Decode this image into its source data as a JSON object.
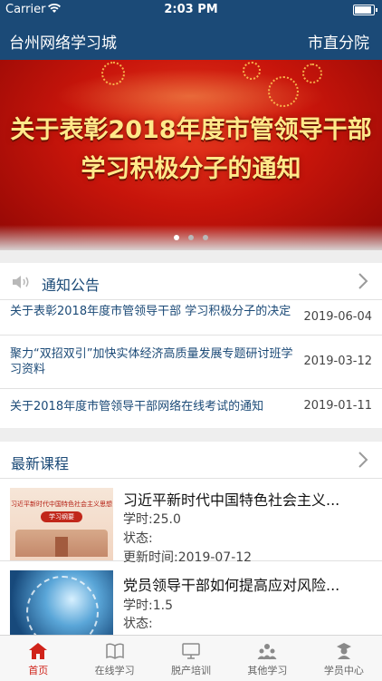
{
  "status_bar": {
    "carrier": "Carrier",
    "time": "2:03 PM"
  },
  "header": {
    "title": "台州网络学习城",
    "branch": "市直分院"
  },
  "banner": {
    "line1": "关于表彰2018年度市管领导干部",
    "line2": "学习积极分子的通知",
    "slide_count": 3,
    "active_slide": 1
  },
  "notices": {
    "title": "通知公告",
    "items": [
      {
        "text": "关于表彰2018年度市管领导干部 学习积极分子的决定",
        "date": "2019-06-04"
      },
      {
        "text": "聚力“双招双引”加快实体经济高质量发展专题研讨班学习资料",
        "date": "2019-03-12"
      },
      {
        "text": "关于2018年度市管领导干部网络在线考试的通知",
        "date": "2019-01-11"
      }
    ]
  },
  "courses": {
    "title": "最新课程",
    "items": [
      {
        "title": "习近平新时代中国特色社会主义...",
        "hours": "学时:25.0",
        "status": "状态:",
        "updated": "更新时间:2019-07-12",
        "thumb_caption": "习近平新时代中国特色社会主义思想",
        "thumb_tag": "学习纲要"
      },
      {
        "title": "党员领导干部如何提高应对风险...",
        "hours": "学时:1.5",
        "status": "状态:"
      }
    ]
  },
  "tab_bar": {
    "tabs": [
      {
        "label": "首页",
        "icon": "home-icon",
        "active": true
      },
      {
        "label": "在线学习",
        "icon": "book-icon",
        "active": false
      },
      {
        "label": "脱产培训",
        "icon": "monitor-icon",
        "active": false
      },
      {
        "label": "其他学习",
        "icon": "people-icon",
        "active": false
      },
      {
        "label": "学员中心",
        "icon": "student-icon",
        "active": false
      }
    ]
  },
  "colors": {
    "header_bg": "#1b4a77",
    "link_text": "#1b4a77",
    "active_tab": "#d0231a",
    "banner_red": "#c8150b"
  }
}
